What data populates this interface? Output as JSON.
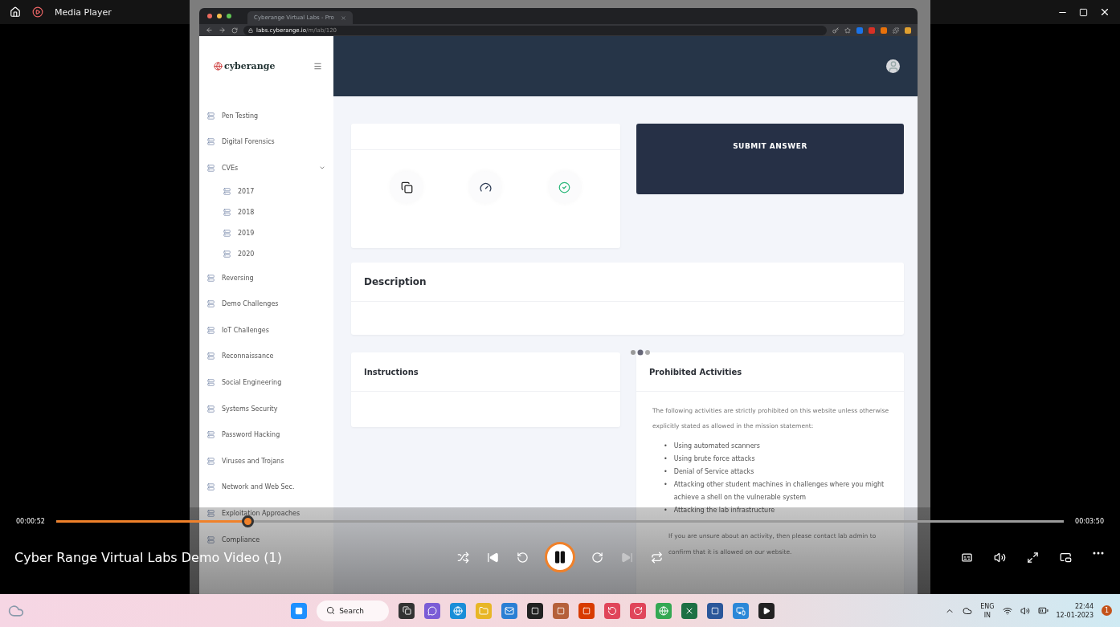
{
  "window": {
    "title": "Media Player"
  },
  "browser": {
    "tab_title": "Cyberange Virtual Labs - Pro",
    "url_host": "labs.cyberange.io",
    "url_path": "/m/lab/120"
  },
  "site": {
    "logo": "cyberange",
    "sidebar": [
      {
        "label": "Pen Testing"
      },
      {
        "label": "Digital Forensics"
      },
      {
        "label": "CVEs",
        "expanded": true,
        "children": [
          {
            "label": "2017"
          },
          {
            "label": "2018"
          },
          {
            "label": "2019"
          },
          {
            "label": "2020"
          }
        ]
      },
      {
        "label": "Reversing"
      },
      {
        "label": "Demo Challenges"
      },
      {
        "label": "IoT Challenges"
      },
      {
        "label": "Reconnaissance"
      },
      {
        "label": "Social Engineering"
      },
      {
        "label": "Systems Security"
      },
      {
        "label": "Password Hacking"
      },
      {
        "label": "Viruses and Trojans"
      },
      {
        "label": "Network and Web Sec."
      },
      {
        "label": "Exploitation Approaches"
      },
      {
        "label": "Compliance"
      }
    ],
    "submit_button": "SUBMIT ANSWER",
    "description_title": "Description",
    "instructions_title": "Instructions",
    "prohibited": {
      "title": "Prohibited Activities",
      "intro": "The following activities are strictly prohibited on this website unless otherwise explicitly stated as allowed in the mission statement:",
      "marker": "•",
      "items": [
        "Using automated scanners",
        "Using brute force attacks",
        "Denial of Service attacks",
        "Attacking other student machines in challenges where you might achieve a shell on the vulnerable system",
        "Attacking the lab infrastructure"
      ],
      "footer": "If you are unsure about an activity, then please contact lab admin to confirm that it is allowed on our website."
    }
  },
  "player": {
    "elapsed": "00:00:52",
    "duration": "00:03:50",
    "level": 0.19,
    "title": "Cyber Range Virtual Labs Demo Video (1)",
    "playing": true,
    "next_disabled": true
  },
  "taskbar": {
    "search": "Search",
    "lang": "ENG",
    "region": "IN",
    "time": "22:44",
    "date": "12-01-2023",
    "notifications": "1"
  }
}
